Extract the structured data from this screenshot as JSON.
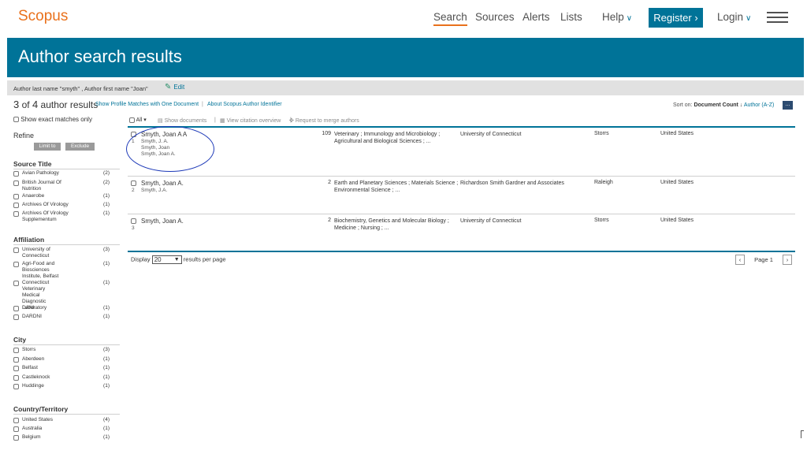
{
  "brand": {
    "logo": "Scopus",
    "accent": "#e9711c",
    "primary": "#007398"
  },
  "nav": {
    "links": [
      "Search",
      "Sources",
      "Alerts",
      "Lists"
    ],
    "help": "Help",
    "register": "Register",
    "login": "Login"
  },
  "banner": {
    "title": "Author search results"
  },
  "query": {
    "text": "Author last name \"smyth\" , Author first name \"Joan\"",
    "edit": "Edit"
  },
  "results_head": {
    "count_shown": "3",
    "of": "of",
    "count_total": "4",
    "suffix": "author results",
    "link_profile": "Show Profile Matches with One Document",
    "link_about": "About Scopus Author Identifier",
    "sort_label": "Sort on:",
    "sort_current": "Document Count ↓",
    "sort_alt": "Author (A-Z)",
    "more": "..."
  },
  "sidebar": {
    "exact": "Show exact matches only",
    "refine": "Refine",
    "limit": "Limit to",
    "exclude": "Exclude",
    "source_title": {
      "title": "Source Title",
      "items": [
        {
          "label": "Avian Pathology",
          "count": "(2)"
        },
        {
          "label": "British Journal Of Nutrition",
          "count": "(2)"
        },
        {
          "label": "Anaerobe",
          "count": "(1)"
        },
        {
          "label": "Archives Of Virology",
          "count": "(1)"
        },
        {
          "label": "Archives Of Virology Supplementum",
          "count": "(1)"
        }
      ]
    },
    "affiliation": {
      "title": "Affiliation",
      "items": [
        {
          "label": "University of Connecticut",
          "count": "(3)"
        },
        {
          "label": "Agri-Food and Biosciences Institute, Belfast",
          "count": "(1)"
        },
        {
          "label": "Connecticut Veterinary Medical Diagnostic Laboratory",
          "count": "(1)"
        },
        {
          "label": "DANI",
          "count": "(1)"
        },
        {
          "label": "DARDNI",
          "count": "(1)"
        }
      ]
    },
    "city": {
      "title": "City",
      "items": [
        {
          "label": "Storrs",
          "count": "(3)"
        },
        {
          "label": "Aberdeen",
          "count": "(1)"
        },
        {
          "label": "Belfast",
          "count": "(1)"
        },
        {
          "label": "Castleknock",
          "count": "(1)"
        },
        {
          "label": "Huddinge",
          "count": "(1)"
        }
      ]
    },
    "country": {
      "title": "Country/Territory",
      "items": [
        {
          "label": "United States",
          "count": "(4)"
        },
        {
          "label": "Australia",
          "count": "(1)"
        },
        {
          "label": "Belgium",
          "count": "(1)"
        }
      ]
    }
  },
  "toolbar": {
    "all": "All",
    "show_documents": "Show documents",
    "citation": "View citation overview",
    "merge": "Request to merge authors"
  },
  "results": [
    {
      "num": "1",
      "name": "Smyth, Joan A A",
      "variants": [
        "Smyth, J. A.",
        "Smyth, Joan",
        "Smyth, Joan A."
      ],
      "docs": "109",
      "subjects": "Veterinary ; Immunology and Microbiology ; Agricultural and Biological Sciences ; ...",
      "affiliation": "University of Connecticut",
      "city": "Storrs",
      "country": "United States"
    },
    {
      "num": "2",
      "name": "Smyth, Joan A.",
      "variants": [
        "Smyth, J.A."
      ],
      "docs": "2",
      "subjects": "Earth and Planetary Sciences ; Materials Science ; Environmental Science ; ...",
      "affiliation": "Richardson Smith Gardner and Associates",
      "city": "Raleigh",
      "country": "United States"
    },
    {
      "num": "3",
      "name": "Smyth, Joan A.",
      "variants": [],
      "docs": "2",
      "subjects": "Biochemistry, Genetics and Molecular Biology ; Medicine ; Nursing ; ...",
      "affiliation": "University of Connecticut",
      "city": "Storrs",
      "country": "United States"
    }
  ],
  "footer": {
    "display_label": "Display",
    "per_page": "20",
    "results_per_page": "results per page",
    "page": "Page 1"
  }
}
